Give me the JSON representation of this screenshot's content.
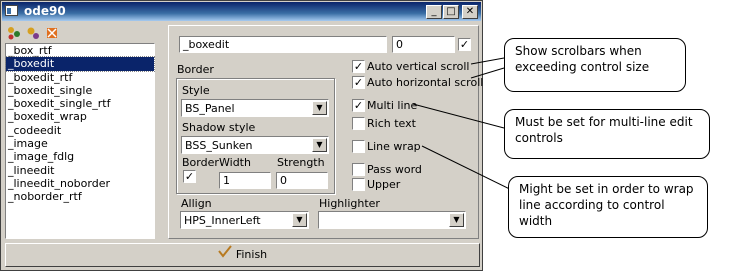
{
  "window": {
    "title": "ode90",
    "buttons": {
      "minimize": "_",
      "maximize": "□",
      "close": "✕"
    }
  },
  "toolbar": {
    "icons": [
      "add-object-icon",
      "remove-object-icon",
      "delete-icon"
    ]
  },
  "list": {
    "items": [
      "_box_rtf",
      "_boxedit",
      "_boxedit_rtf",
      "_boxedit_single",
      "_boxedit_single_rtf",
      "_boxedit_wrap",
      "_codeedit",
      "_image",
      "_image_fdlg",
      "_lineedit",
      "_lineedit_noborder",
      "_noborder_rtf"
    ],
    "selected_index": 1
  },
  "props": {
    "name_value": "_boxedit",
    "index_value": "0",
    "index_checked": true,
    "border_label": "Border",
    "style_label": "Style",
    "style_value": "BS_Panel",
    "shadow_label": "Shadow style",
    "shadow_value": "BSS_Sunken",
    "border_chk_label": "Border",
    "border_checked": true,
    "width_label": "Width",
    "width_value": "1",
    "strength_label": "Strength",
    "strength_value": "0",
    "allign_label": "Allign",
    "allign_value": "HPS_InnerLeft",
    "highlighter_label": "Highlighter",
    "highlighter_value": ""
  },
  "checkboxes": {
    "auto_vertical": {
      "label": "Auto vertical scroll",
      "checked": true
    },
    "auto_horizontal": {
      "label": "Auto horizontal scroll",
      "checked": true
    },
    "multi_line": {
      "label": "Multi line",
      "checked": true
    },
    "rich_text": {
      "label": "Rich text",
      "checked": false
    },
    "line_wrap": {
      "label": "Line wrap",
      "checked": false
    },
    "pass_word": {
      "label": "Pass word",
      "checked": false
    },
    "upper": {
      "label": "Upper",
      "checked": false
    }
  },
  "finish_label": "Finish",
  "notes": {
    "scrollbars": "Show scrolbars when exceeding control size",
    "multiline": "Must be set for multi-line edit controls",
    "wrap": "Might be set in order to wrap line according to control width"
  }
}
